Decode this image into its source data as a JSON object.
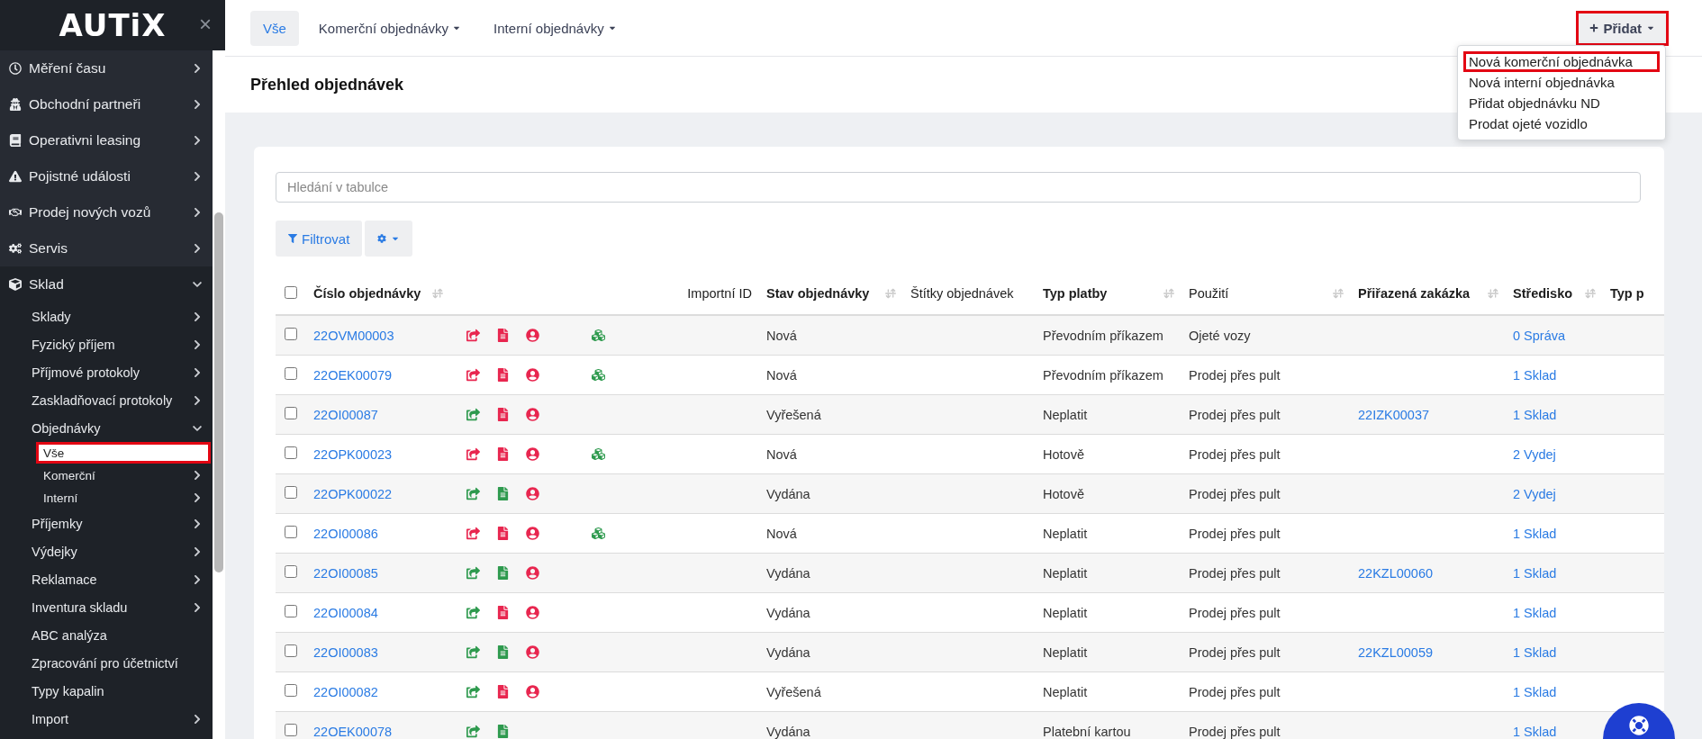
{
  "sidebar": {
    "logo": "AUTiX",
    "close": "×",
    "items": [
      {
        "label": "Měření času",
        "kind": "group",
        "expanded": false
      },
      {
        "label": "Obchodní partneři",
        "kind": "group",
        "expanded": false
      },
      {
        "label": "Operativni leasing",
        "kind": "group",
        "expanded": false
      },
      {
        "label": "Pojistné události",
        "kind": "group",
        "expanded": false
      },
      {
        "label": "Prodej nových vozů",
        "kind": "group",
        "expanded": false
      },
      {
        "label": "Servis",
        "kind": "group",
        "expanded": false
      },
      {
        "label": "Sklad",
        "kind": "group",
        "expanded": true,
        "children": [
          {
            "label": "Sklady",
            "kind": "group",
            "expanded": false
          },
          {
            "label": "Fyzický příjem",
            "kind": "group",
            "expanded": false
          },
          {
            "label": "Příjmové protokoly",
            "kind": "group",
            "expanded": false
          },
          {
            "label": "Zaskladňovací protokoly",
            "kind": "group",
            "expanded": false
          },
          {
            "label": "Objednávky",
            "kind": "group",
            "expanded": true,
            "children": [
              {
                "label": "Vše",
                "kind": "link",
                "selected": true,
                "highlighted": true
              },
              {
                "label": "Komerční",
                "kind": "group",
                "expanded": false,
                "selected": false,
                "highlighted": false
              },
              {
                "label": "Interní",
                "kind": "group",
                "expanded": false,
                "selected": false,
                "highlighted": false
              }
            ]
          },
          {
            "label": "Příjemky",
            "kind": "group",
            "expanded": false
          },
          {
            "label": "Výdejky",
            "kind": "group",
            "expanded": false
          },
          {
            "label": "Reklamace",
            "kind": "group",
            "expanded": false
          },
          {
            "label": "Inventura skladu",
            "kind": "group",
            "expanded": false
          },
          {
            "label": "ABC analýza",
            "kind": "link"
          },
          {
            "label": "Zpracování pro účetnictví",
            "kind": "link"
          },
          {
            "label": "Typy kapalin",
            "kind": "link"
          },
          {
            "label": "Import",
            "kind": "group",
            "expanded": false
          }
        ]
      }
    ]
  },
  "tabs": [
    {
      "label": "Vše",
      "selected": true,
      "dropdown": false
    },
    {
      "label": "Komerční objednávky",
      "selected": false,
      "dropdown": true
    },
    {
      "label": "Interní objednávky",
      "selected": false,
      "dropdown": true
    }
  ],
  "add_button": {
    "label": "Přidat",
    "highlighted": true,
    "menu": [
      {
        "label": "Nová komerční objednávka",
        "highlighted": true
      },
      {
        "label": "Nová interní objednávka",
        "highlighted": false
      },
      {
        "label": "Přidat objednávku ND",
        "highlighted": false
      },
      {
        "label": "Prodat ojeté vozidlo",
        "highlighted": false
      }
    ]
  },
  "page_title": "Přehled objednávek",
  "search": {
    "placeholder": "Hledání v tabulce"
  },
  "filter_button": "Filtrovat",
  "table": {
    "all_checked": false,
    "columns": [
      {
        "label": "Číslo objednávky",
        "sortable": true
      },
      {
        "sortable": false
      },
      {
        "label": "Importní ID",
        "sortable": false
      },
      {
        "label": "Stav objednávky",
        "sortable": true
      },
      {
        "label": "Štítky objednávek",
        "sortable": false
      },
      {
        "label": "Typ platby",
        "sortable": true
      },
      {
        "label": "Použití",
        "sortable": true
      },
      {
        "label": "Přiřazená zakázka",
        "sortable": true
      },
      {
        "label": "Středisko",
        "sortable": true
      },
      {
        "label": "Typ p",
        "sortable": false
      }
    ],
    "rows": [
      {
        "checked": false,
        "number": "22OVM00003",
        "icons": [
          {
            "kind": "share",
            "color": "#e8264f"
          },
          {
            "kind": "document",
            "color": "#e8264f"
          },
          {
            "kind": "user",
            "color": "#e8264f"
          },
          {
            "kind": "cubes",
            "color": "#2e9a4e"
          }
        ],
        "status": "Nová",
        "payment": "Převodním příkazem",
        "usage": "Ojeté vozy",
        "center": "0 Správa"
      },
      {
        "checked": false,
        "number": "22OEK00079",
        "icons": [
          {
            "kind": "share",
            "color": "#e8264f"
          },
          {
            "kind": "document",
            "color": "#e8264f"
          },
          {
            "kind": "user",
            "color": "#e8264f"
          },
          {
            "kind": "cubes",
            "color": "#2e9a4e"
          }
        ],
        "status": "Nová",
        "payment": "Převodním příkazem",
        "usage": "Prodej přes pult",
        "center": "1 Sklad"
      },
      {
        "checked": false,
        "number": "22OI00087",
        "icons": [
          {
            "kind": "share",
            "color": "#2e9a4e"
          },
          {
            "kind": "document",
            "color": "#e8264f"
          },
          {
            "kind": "user",
            "color": "#e8264f"
          }
        ],
        "status": "Vyřešená",
        "payment": "Neplatit",
        "usage": "Prodej přes pult",
        "job": "22IZK00037",
        "center": "1 Sklad"
      },
      {
        "checked": false,
        "number": "22OPK00023",
        "icons": [
          {
            "kind": "share",
            "color": "#e8264f"
          },
          {
            "kind": "document",
            "color": "#e8264f"
          },
          {
            "kind": "user",
            "color": "#e8264f"
          },
          {
            "kind": "cubes",
            "color": "#2e9a4e"
          }
        ],
        "status": "Nová",
        "payment": "Hotově",
        "usage": "Prodej přes pult",
        "center": "2 Vydej"
      },
      {
        "checked": false,
        "number": "22OPK00022",
        "icons": [
          {
            "kind": "share",
            "color": "#2e9a4e"
          },
          {
            "kind": "document",
            "color": "#2e9a4e"
          },
          {
            "kind": "user",
            "color": "#e8264f"
          }
        ],
        "status": "Vydána",
        "payment": "Hotově",
        "usage": "Prodej přes pult",
        "center": "2 Vydej"
      },
      {
        "checked": false,
        "number": "22OI00086",
        "icons": [
          {
            "kind": "share",
            "color": "#e8264f"
          },
          {
            "kind": "document",
            "color": "#e8264f"
          },
          {
            "kind": "user",
            "color": "#e8264f"
          },
          {
            "kind": "cubes",
            "color": "#2e9a4e"
          }
        ],
        "status": "Nová",
        "payment": "Neplatit",
        "usage": "Prodej přes pult",
        "center": "1 Sklad"
      },
      {
        "checked": false,
        "number": "22OI00085",
        "icons": [
          {
            "kind": "share",
            "color": "#2e9a4e"
          },
          {
            "kind": "document",
            "color": "#2e9a4e"
          },
          {
            "kind": "user",
            "color": "#e8264f"
          }
        ],
        "status": "Vydána",
        "payment": "Neplatit",
        "usage": "Prodej přes pult",
        "job": "22KZL00060",
        "center": "1 Sklad"
      },
      {
        "checked": false,
        "number": "22OI00084",
        "icons": [
          {
            "kind": "share",
            "color": "#2e9a4e"
          },
          {
            "kind": "document",
            "color": "#e8264f"
          },
          {
            "kind": "user",
            "color": "#e8264f"
          }
        ],
        "status": "Vydána",
        "payment": "Neplatit",
        "usage": "Prodej přes pult",
        "center": "1 Sklad"
      },
      {
        "checked": false,
        "number": "22OI00083",
        "icons": [
          {
            "kind": "share",
            "color": "#2e9a4e"
          },
          {
            "kind": "document",
            "color": "#2e9a4e"
          },
          {
            "kind": "user",
            "color": "#e8264f"
          }
        ],
        "status": "Vydána",
        "payment": "Neplatit",
        "usage": "Prodej přes pult",
        "job": "22KZL00059",
        "center": "1 Sklad"
      },
      {
        "checked": false,
        "number": "22OI00082",
        "icons": [
          {
            "kind": "share",
            "color": "#2e9a4e"
          },
          {
            "kind": "document",
            "color": "#e8264f"
          },
          {
            "kind": "user",
            "color": "#e8264f"
          }
        ],
        "status": "Vyřešená",
        "payment": "Neplatit",
        "usage": "Prodej přes pult",
        "center": "1 Sklad"
      },
      {
        "checked": false,
        "number": "22OEK00078",
        "icons": [
          {
            "kind": "share",
            "color": "#2e9a4e"
          },
          {
            "kind": "document",
            "color": "#2e9a4e"
          }
        ],
        "status": "Vydána",
        "payment": "Platební kartou",
        "usage": "Prodej přes pult",
        "center": "1 Sklad"
      }
    ]
  }
}
